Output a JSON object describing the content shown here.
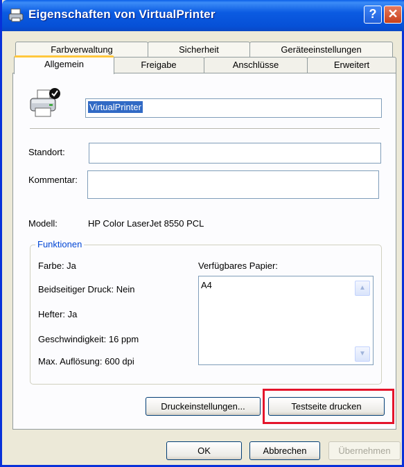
{
  "window": {
    "title": "Eigenschaften von VirtualPrinter",
    "help_label": "?",
    "close_label": "✕"
  },
  "tabs_row1": [
    "Farbverwaltung",
    "Sicherheit",
    "Geräteeinstellungen"
  ],
  "tabs_row2": [
    "Allgemein",
    "Freigabe",
    "Anschlüsse",
    "Erweitert"
  ],
  "active_tab": "Allgemein",
  "general": {
    "printer_name": "VirtualPrinter",
    "location_label": "Standort:",
    "location_value": "",
    "comment_label": "Kommentar:",
    "comment_value": "",
    "model_label": "Modell:",
    "model_value": "HP Color LaserJet 8550 PCL"
  },
  "features": {
    "title": "Funktionen",
    "color": "Farbe: Ja",
    "duplex": "Beidseitiger Druck: Nein",
    "staple": "Hefter: Ja",
    "speed": "Geschwindigkeit: 16 ppm",
    "resolution": "Max. Auflösung: 600 dpi",
    "paper_label": "Verfügbares Papier:",
    "paper_items": [
      "A4"
    ]
  },
  "buttons": {
    "preferences": "Druckeinstellungen...",
    "test_page": "Testseite drucken",
    "ok": "OK",
    "cancel": "Abbrechen",
    "apply": "Übernehmen"
  },
  "icons": {
    "title": "printer-icon",
    "printer": "printer-icon"
  }
}
